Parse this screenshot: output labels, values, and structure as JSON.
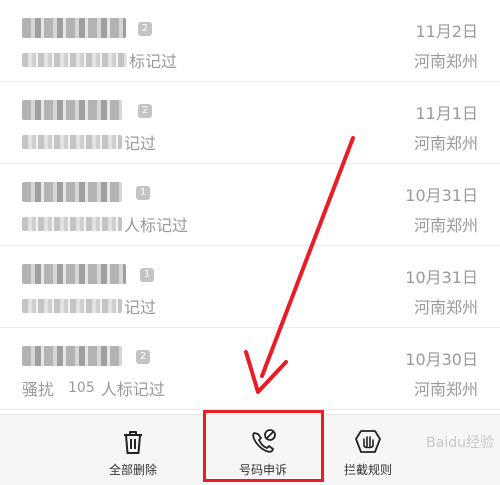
{
  "call_log": [
    {
      "sim": "2",
      "tag_suffix": "标记过",
      "date": "11月2日",
      "location": "河南郑州"
    },
    {
      "sim": "2",
      "tag_suffix": "记过",
      "date": "11月1日",
      "location": "河南郑州"
    },
    {
      "sim": "1",
      "tag_suffix": "人标记过",
      "date": "10月31日",
      "location": "河南郑州"
    },
    {
      "sim": "1",
      "tag_suffix": "记过",
      "date": "10月31日",
      "location": "河南郑州"
    },
    {
      "sim": "2",
      "tag_prefix": "骚扰",
      "tag_count": "105",
      "tag_suffix": "人标记过",
      "date": "10月30日",
      "location": "河南郑州"
    }
  ],
  "bottom_bar": {
    "delete_all_label": "全部删除",
    "number_appeal_label": "号码申诉",
    "block_rules_label": "拦截规则"
  },
  "icons": {
    "delete": "trash-icon",
    "appeal": "phone-slash-icon",
    "rules": "shield-hand-icon"
  },
  "colors": {
    "annotation": "#e81d25",
    "muted_text": "#9a9a9a",
    "bar_bg": "#f6f6f6"
  },
  "watermark": "Baidu经验"
}
